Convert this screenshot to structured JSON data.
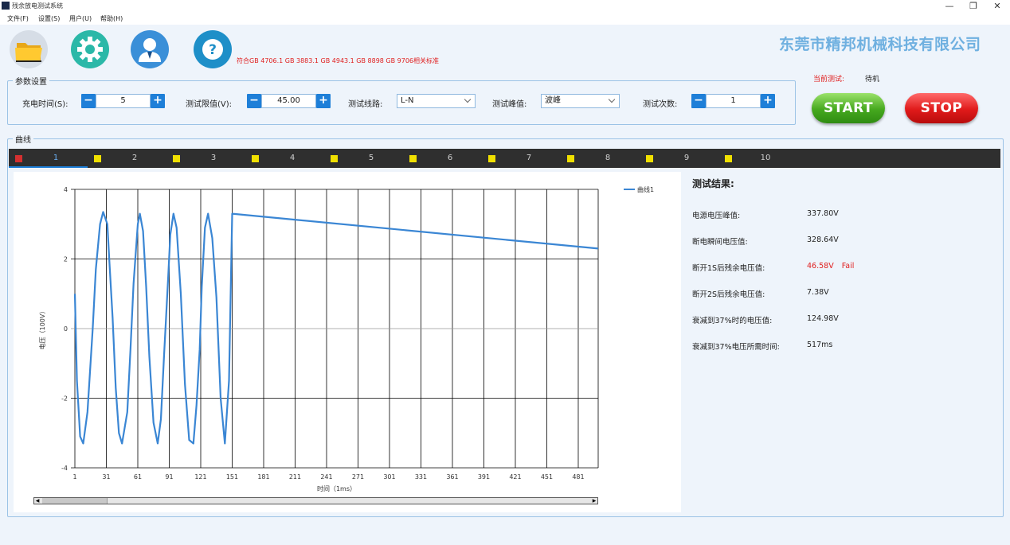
{
  "window": {
    "title": "残余放电测试系统"
  },
  "menu": [
    "文件(F)",
    "设置(S)",
    "用户(U)",
    "帮助(H)"
  ],
  "toolbar": {
    "standard_text": "符合GB 4706.1 GB 3883.1 GB 4943.1 GB 8898 GB 9706相关标准",
    "company": "东莞市精邦机械科技有限公司"
  },
  "params": {
    "legend": "参数设置",
    "charge_time_label": "充电时间(S):",
    "charge_time_value": "5",
    "limit_label": "测试限值(V):",
    "limit_value": "45.00",
    "line_label": "测试线路:",
    "line_value": "L-N",
    "peak_label": "测试峰值:",
    "peak_value": "波峰",
    "count_label": "测试次数:",
    "count_value": "1"
  },
  "status": {
    "label": "当前测试:",
    "value": "待机",
    "start_label": "START",
    "stop_label": "STOP"
  },
  "curves": {
    "legend": "曲线",
    "tabs": [
      {
        "label": "1",
        "color": "#d43030"
      },
      {
        "label": "2",
        "color": "#f0e000"
      },
      {
        "label": "3",
        "color": "#f0e000"
      },
      {
        "label": "4",
        "color": "#f0e000"
      },
      {
        "label": "5",
        "color": "#f0e000"
      },
      {
        "label": "6",
        "color": "#f0e000"
      },
      {
        "label": "7",
        "color": "#f0e000"
      },
      {
        "label": "8",
        "color": "#f0e000"
      },
      {
        "label": "9",
        "color": "#f0e000"
      },
      {
        "label": "10",
        "color": "#f0e000"
      }
    ],
    "active_tab": 0
  },
  "chart_data": {
    "type": "line",
    "ylabel": "电压（100V）",
    "xlabel": "时间（1ms）",
    "xlim": [
      1,
      500
    ],
    "ylim": [
      -4,
      4
    ],
    "x_ticks": [
      "1",
      "31",
      "61",
      "91",
      "121",
      "151",
      "181",
      "211",
      "241",
      "271",
      "301",
      "331",
      "361",
      "391",
      "421",
      "451",
      "481"
    ],
    "y_ticks": [
      "4",
      "2",
      "0",
      "-2",
      "-4"
    ],
    "grid": true,
    "legend_position": "top-right",
    "series": [
      {
        "name": "曲线1",
        "color": "#3a86d4",
        "x": [
          1,
          3,
          6,
          9,
          13,
          18,
          21,
          25,
          28,
          32,
          34,
          37,
          40,
          43,
          46,
          51,
          54,
          57,
          61,
          63,
          66,
          69,
          72,
          76,
          80,
          83,
          86,
          90,
          92,
          95,
          98,
          102,
          106,
          110,
          114,
          117,
          120,
          122,
          125,
          128,
          132,
          136,
          140,
          144,
          148,
          151,
          500
        ],
        "y": [
          1.0,
          -1.5,
          -3.1,
          -3.3,
          -2.4,
          0.0,
          1.7,
          3.0,
          3.35,
          3.0,
          1.9,
          0.3,
          -1.7,
          -3.0,
          -3.3,
          -2.4,
          -0.6,
          1.3,
          3.0,
          3.3,
          2.8,
          1.2,
          -0.8,
          -2.7,
          -3.3,
          -2.6,
          -0.8,
          1.5,
          2.7,
          3.3,
          2.9,
          1.0,
          -1.6,
          -3.2,
          -3.3,
          -2.2,
          -0.6,
          1.2,
          2.9,
          3.3,
          2.6,
          0.9,
          -2.0,
          -3.3,
          -1.5,
          3.3,
          2.3
        ]
      }
    ]
  },
  "results": {
    "title": "测试结果:",
    "items": [
      {
        "label": "电源电压峰值:",
        "value": "337.80V",
        "fail": ""
      },
      {
        "label": "断电瞬间电压值:",
        "value": "328.64V",
        "fail": ""
      },
      {
        "label": "断开1S后残余电压值:",
        "value": "46.58V",
        "fail": "Fail"
      },
      {
        "label": "断开2S后残余电压值:",
        "value": "7.38V",
        "fail": ""
      },
      {
        "label": "衰减到37%时的电压值:",
        "value": "124.98V",
        "fail": ""
      },
      {
        "label": "衰减到37%电压所需时间:",
        "value": "517ms",
        "fail": ""
      }
    ]
  }
}
